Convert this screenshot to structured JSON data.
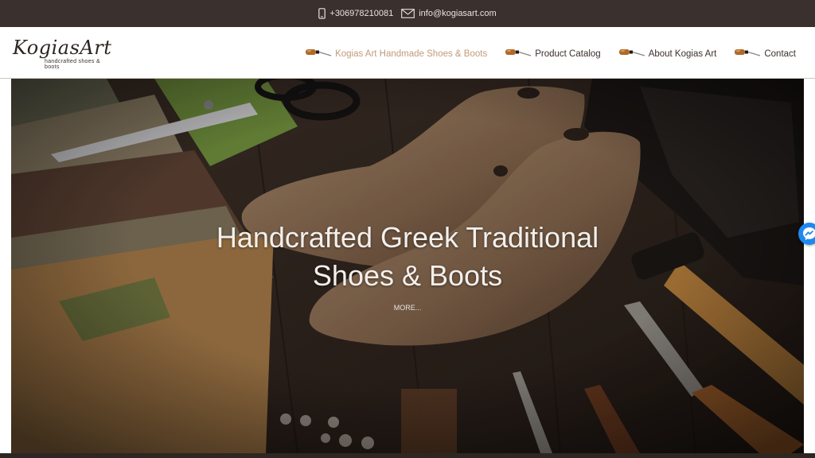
{
  "topbar": {
    "phone": "+306978210081",
    "email": "info@kogiasart.com",
    "phone_icon": "phone-icon",
    "email_icon": "envelope-icon"
  },
  "logo": {
    "name": "KogiasArt",
    "tagline": "handcrafted shoes & boots"
  },
  "nav": {
    "items": [
      {
        "label": "Kogias Art Handmade Shoes & Boots",
        "icon": "awl-icon",
        "active": true
      },
      {
        "label": "Product Catalog",
        "icon": "awl-icon",
        "active": false
      },
      {
        "label": "About Kogias Art",
        "icon": "awl-icon",
        "active": false
      },
      {
        "label": "Contact",
        "icon": "awl-icon",
        "active": false
      }
    ]
  },
  "hero": {
    "title_line1": "Handcrafted Greek Traditional",
    "title_line2": "Shoes & Boots",
    "more_label": "MORE...",
    "image_subject": "wooden shoe lasts with cobbler tools"
  },
  "messenger": {
    "icon": "messenger-icon"
  },
  "colors": {
    "topbar_bg": "#3a302d",
    "accent": "#c29a7a",
    "nav_text": "#3b302c",
    "hero_text": "#f3efec"
  }
}
